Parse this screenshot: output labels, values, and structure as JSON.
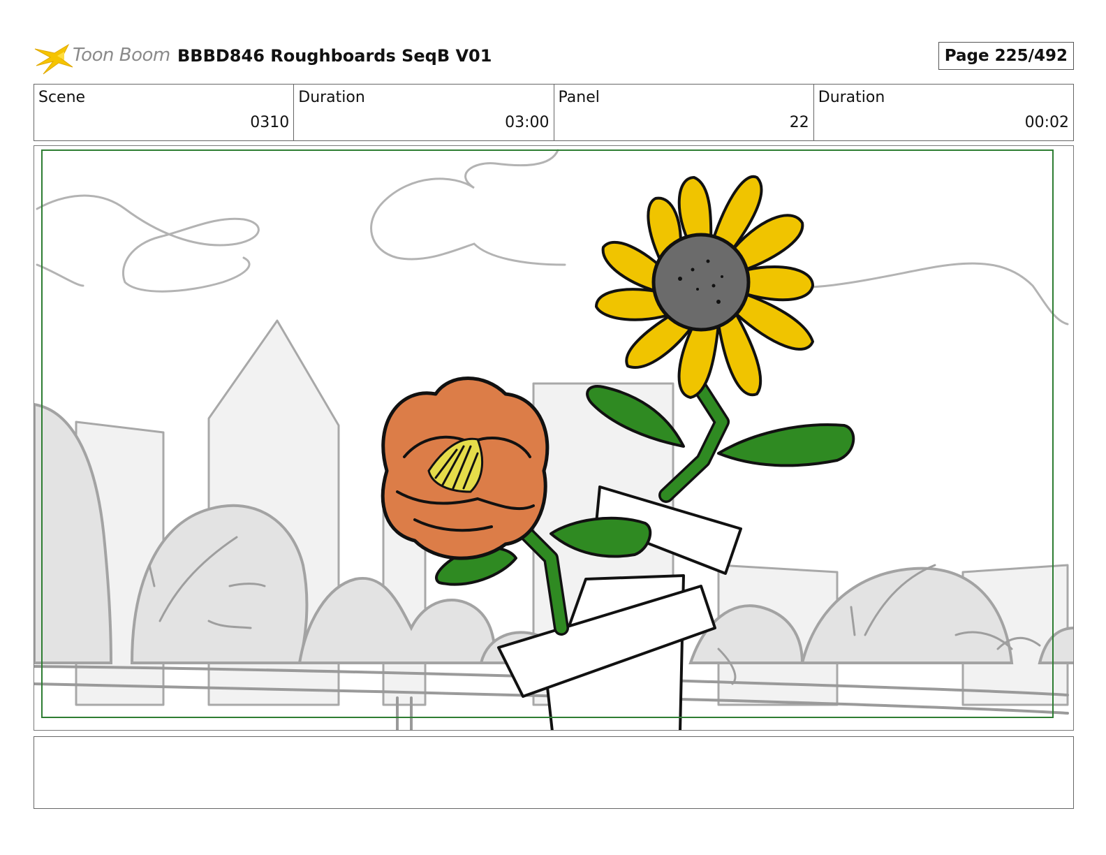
{
  "header": {
    "logo_text": "Toon Boom",
    "title": "BBBD846 Roughboards SeqB V01",
    "page": "Page 225/492"
  },
  "info": {
    "scene_label": "Scene",
    "scene_value": "0310",
    "scene_duration_label": "Duration",
    "scene_duration_value": "03:00",
    "panel_label": "Panel",
    "panel_value": "22",
    "panel_duration_label": "Duration",
    "panel_duration_value": "00:02"
  },
  "notes": {
    "text": ""
  },
  "colors": {
    "logo_yellow": "#f5c400",
    "sunflower_petals": "#f0c400",
    "sunflower_center": "#6b6b6b",
    "poppy": "#dc7d48",
    "leaf_green": "#2f8a22",
    "safe_frame": "#2e7d32",
    "background_sketch": "#a8a8a8"
  }
}
